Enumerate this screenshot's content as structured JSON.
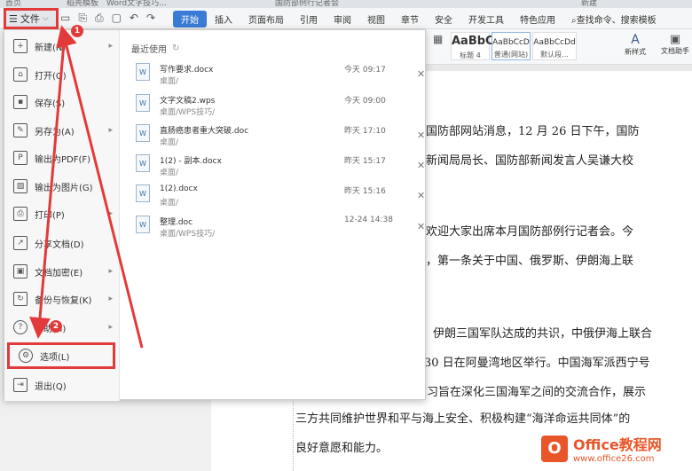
{
  "tabstrip": {
    "items": [
      "首页",
      "稻壳模板",
      "Word文字技巧...",
      "国防部例行记者会",
      "新建"
    ]
  },
  "toolbar": {
    "file_label": "文件",
    "tabs": [
      {
        "label": "开始",
        "active": true
      },
      {
        "label": "插入"
      },
      {
        "label": "页面布局"
      },
      {
        "label": "引用"
      },
      {
        "label": "审阅"
      },
      {
        "label": "视图"
      },
      {
        "label": "章节"
      },
      {
        "label": "安全"
      },
      {
        "label": "开发工具"
      },
      {
        "label": "特色应用"
      }
    ],
    "search_label": "查找命令、搜索模板"
  },
  "ribbon": {
    "styles": [
      {
        "preview": "AaBbC",
        "caption": "标题 4"
      },
      {
        "preview": "AaBbCcD",
        "caption": "普通(网站)"
      },
      {
        "preview": "AaBbCcDd",
        "caption": "默认段..."
      }
    ],
    "new_style": "新样式",
    "writer_helper": "文档助手"
  },
  "file_menu": {
    "items": [
      {
        "label": "新建(N)",
        "icon": "new-icon",
        "submenu": true
      },
      {
        "label": "打开(O)",
        "icon": "open-icon",
        "submenu": false
      },
      {
        "label": "保存(S)",
        "icon": "save-icon",
        "submenu": false
      },
      {
        "label": "另存为(A)",
        "icon": "save-as-icon",
        "submenu": true
      },
      {
        "label": "输出为PDF(F)",
        "icon": "pdf-icon",
        "submenu": false
      },
      {
        "label": "输出为图片(G)",
        "icon": "image-icon",
        "submenu": false
      },
      {
        "label": "打印(P)",
        "icon": "print-icon",
        "submenu": true
      },
      {
        "label": "分享文档(D)",
        "icon": "share-icon",
        "submenu": false
      },
      {
        "label": "文档加密(E)",
        "icon": "lock-icon",
        "submenu": true
      },
      {
        "label": "备份与恢复(K)",
        "icon": "backup-icon",
        "submenu": true
      },
      {
        "label": "帮助(H)",
        "icon": "help-icon",
        "submenu": true
      },
      {
        "label": "选项(L)",
        "icon": "gear-icon",
        "submenu": false
      },
      {
        "label": "退出(Q)",
        "icon": "exit-icon",
        "submenu": false
      }
    ],
    "recent_title": "最近使用",
    "recent": [
      {
        "name": "写作要求.docx",
        "path": "桌面/",
        "time": "今天 09:17"
      },
      {
        "name": "文字文稿2.wps",
        "path": "桌面/WPS技巧/",
        "time": "今天 09:00"
      },
      {
        "name": "直肠癌患者重大突破.doc",
        "path": "桌面/",
        "time": "昨天 17:10"
      },
      {
        "name": "1(2) - 副本.docx",
        "path": "桌面/",
        "time": "昨天 15:17"
      },
      {
        "name": "1(2).docx",
        "path": "桌面/",
        "time": "昨天 15:16"
      },
      {
        "name": "整理.doc",
        "path": "桌面/WPS技巧/",
        "time": "12-24 14:38"
      }
    ]
  },
  "annotations": {
    "badge1": "1",
    "badge2": "2"
  },
  "document": {
    "lines": [
      "电据国防部网站消息，12 月 26 日下午，国防",
      "防部新闻局局长、国防部新闻发言人吴谦大校",
      "友，欢迎大家出席本月国防部例行记者会。今",
      "发布，第一条关于中国、俄罗斯、伊朗海上联",
      "伊朗三国军队达成的共识，中俄伊海上联合",
      "30 日在阿曼湾地区举行。中国海军派西宁号",
      "演习旨在深化三国海军之间的交流合作，展示",
      "三方共同维护世界和平与海上安全、积极构建“海洋命运共同体”的",
      "良好意愿和能力。"
    ]
  },
  "watermark": {
    "brand": "Office教程网",
    "url": "www.office26.com",
    "logo_letter": "O"
  }
}
